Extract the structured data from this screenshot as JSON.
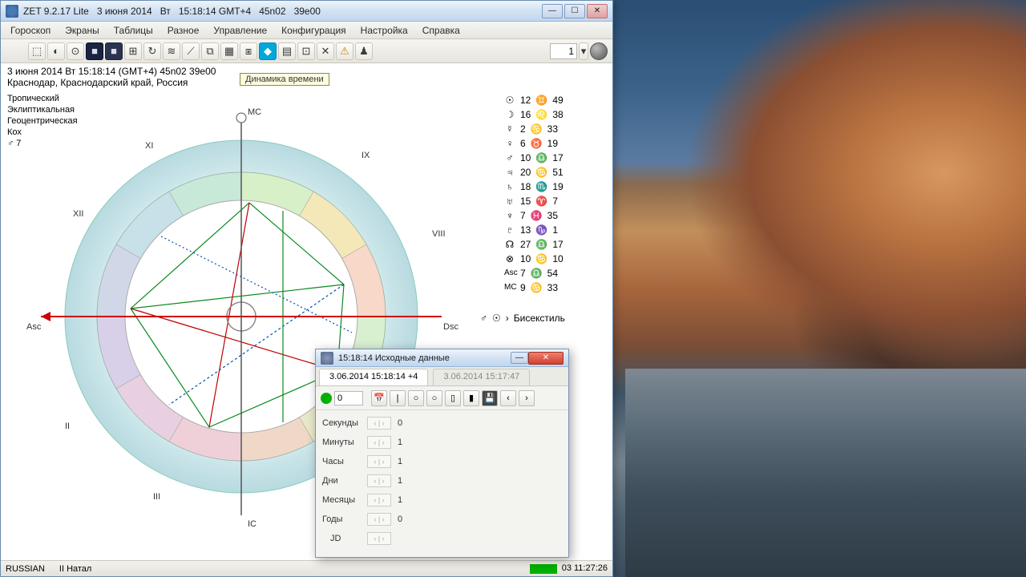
{
  "window": {
    "app": "ZET 9.2.17 Lite",
    "date": "3 июня 2014",
    "dow": "Вт",
    "time": "15:18:14 GMT+4",
    "lat": "45n02",
    "lon": "39e00"
  },
  "menus": [
    "Гороскоп",
    "Экраны",
    "Таблицы",
    "Разное",
    "Управление",
    "Конфигурация",
    "Настройка",
    "Справка"
  ],
  "toolbar_num": "1",
  "tooltip": "Динамика времени",
  "info": {
    "line1": "3 июня 2014   Вт   15:18:14  (GMT+4)  45n02   39e00",
    "line2": "Краснодар, Краснодарский край, Россия"
  },
  "settings_labels": {
    "zodiac": "Тропический",
    "coord": "Эклиптикальная",
    "center": "Геоцентрическая",
    "houses": "Кох",
    "extra": "♂   7"
  },
  "houses": {
    "MC": "MC",
    "IC": "IC",
    "Asc": "Asc",
    "Dsc": "Dsc",
    "II": "II",
    "III": "III",
    "VIII": "VIII",
    "IX": "IX",
    "XI": "XI",
    "XII": "XII"
  },
  "planets": [
    {
      "sym": "☉",
      "deg": "12",
      "sign": "♊",
      "min": "49"
    },
    {
      "sym": "☽",
      "deg": "16",
      "sign": "♌",
      "min": "38"
    },
    {
      "sym": "☿",
      "deg": "2",
      "sign": "♋",
      "min": "33"
    },
    {
      "sym": "♀",
      "deg": "6",
      "sign": "♉",
      "min": "19"
    },
    {
      "sym": "♂",
      "deg": "10",
      "sign": "♎",
      "min": "17"
    },
    {
      "sym": "♃",
      "deg": "20",
      "sign": "♋",
      "min": "51"
    },
    {
      "sym": "♄",
      "deg": "18",
      "sign": "♏",
      "min": "19"
    },
    {
      "sym": "♅",
      "deg": "15",
      "sign": "♈",
      "min": "7"
    },
    {
      "sym": "♆",
      "deg": "7",
      "sign": "♓",
      "min": "35"
    },
    {
      "sym": "♇",
      "deg": "13",
      "sign": "♑",
      "min": "1"
    },
    {
      "sym": "☊",
      "deg": "27",
      "sign": "♎",
      "min": "17"
    },
    {
      "sym": "⊗",
      "deg": "10",
      "sign": "♋",
      "min": "10"
    },
    {
      "sym": "Asc",
      "deg": "7",
      "sign": "♎",
      "min": "54"
    },
    {
      "sym": "MC",
      "deg": "9",
      "sign": "♋",
      "min": "33"
    }
  ],
  "aspect_label": "Бисекстиль",
  "dialog": {
    "title": "15:18:14  Исходные данные",
    "tab_active": "3.06.2014  15:18:14  +4",
    "tab_inactive": "3.06.2014   15:17:47",
    "tools_num": "0",
    "rows": [
      {
        "label": "Секунды",
        "value": "0"
      },
      {
        "label": "Минуты",
        "value": "1"
      },
      {
        "label": "Часы",
        "value": "1"
      },
      {
        "label": "Дни",
        "value": "1"
      },
      {
        "label": "Месяцы",
        "value": "1"
      },
      {
        "label": "Годы",
        "value": "0"
      },
      {
        "label": "JD",
        "value": ""
      }
    ]
  },
  "status": {
    "lang": "RUSSIAN",
    "name": "II Натал",
    "right": "03 11:27:26"
  }
}
